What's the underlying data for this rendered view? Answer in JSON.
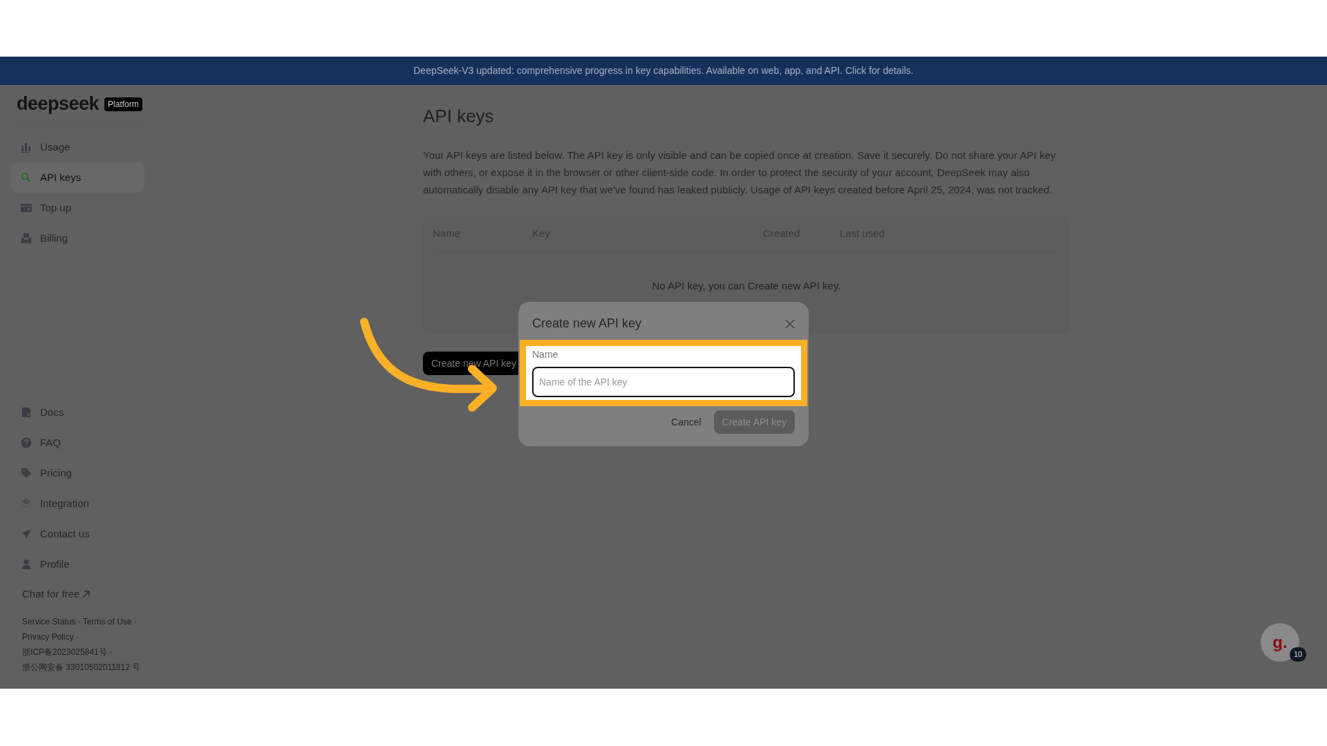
{
  "banner": {
    "text": "DeepSeek-V3 updated: comprehensive progress in key capabilities. Available on web, app, and API.",
    "link": "Click for details."
  },
  "sidebar": {
    "logo": "deepseek",
    "badge": "Platform",
    "items": [
      {
        "label": "Usage",
        "selected": false
      },
      {
        "label": "API keys",
        "selected": true
      },
      {
        "label": "Top up",
        "selected": false
      },
      {
        "label": "Billing",
        "selected": false
      }
    ],
    "bottom_items": [
      {
        "label": "Docs"
      },
      {
        "label": "FAQ"
      },
      {
        "label": "Pricing"
      },
      {
        "label": "Integration"
      },
      {
        "label": "Contact us"
      },
      {
        "label": "Profile"
      }
    ],
    "chat_link": "Chat for free",
    "footer_separator": "·",
    "footer": [
      {
        "text": "Service Status"
      },
      {
        "text": "Terms of Use"
      },
      {
        "text": "Privacy Policy"
      },
      {
        "text": "浙ICP备2023025841号"
      },
      {
        "text": "浙公网安备 33010502011812 号"
      }
    ]
  },
  "main": {
    "title": "API keys",
    "description": "Your API keys are listed below. The API key is only visible and can be copied once at creation. Save it securely. Do not share your API key with others, or expose it in the browser or other client-side code. In order to protect the security of your account, DeepSeek may also automatically disable any API key that we've found has leaked publicly. Usage of API keys created before April 25, 2024, was not tracked.",
    "table": {
      "columns": [
        "Name",
        "Key",
        "Created",
        "Last used"
      ],
      "empty_text": "No API key, you can",
      "empty_link": "Create new API key",
      "empty_end": "."
    },
    "create_button": "Create new API key"
  },
  "modal": {
    "title": "Create new API key",
    "field_label": "Name",
    "placeholder": "Name of the API key",
    "cancel": "Cancel",
    "submit": "Create API key",
    "submit_disabled": true
  },
  "chat_widget": {
    "logo": "g.",
    "count": "10"
  }
}
